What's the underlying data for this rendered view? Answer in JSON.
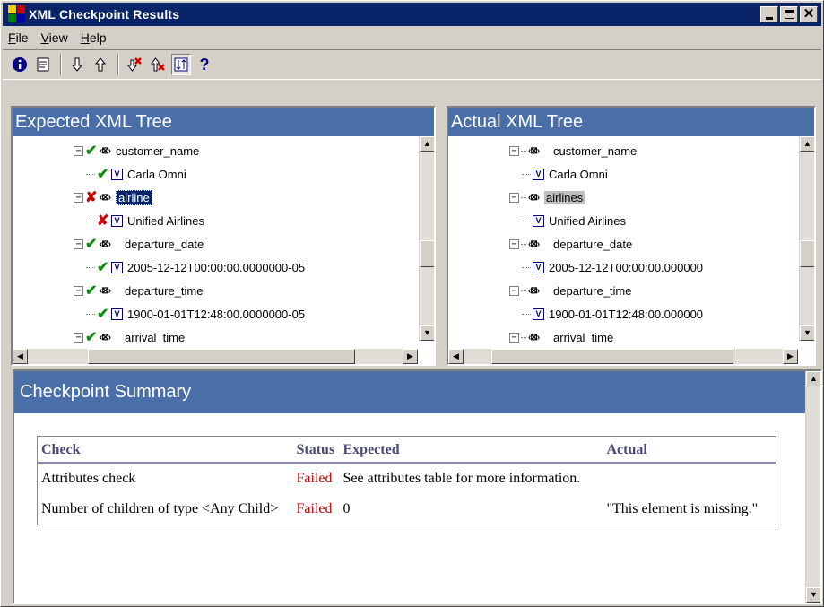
{
  "window": {
    "title": "XML Checkpoint Results"
  },
  "menu": [
    "File",
    "View",
    "Help"
  ],
  "toolbar": {
    "info_icon": "info-icon",
    "properties_icon": "properties-icon",
    "next_diff": "down-arrow-icon",
    "prev_diff": "up-arrow-icon",
    "next_fail": "next-failure-icon",
    "prev_fail": "previous-failure-icon",
    "sync": "synchronize-icon",
    "help": "?"
  },
  "expected": {
    "header": "Expected XML Tree",
    "nodes": [
      {
        "label": "customer_name"
      },
      {
        "label": "Carla Omni"
      },
      {
        "label": "airline"
      },
      {
        "label": "Unified Airlines"
      },
      {
        "label": "departure_date"
      },
      {
        "label": "2005-12-12T00:00:00.0000000-05"
      },
      {
        "label": "departure_time"
      },
      {
        "label": "1900-01-01T12:48:00.0000000-05"
      },
      {
        "label": "arrival_time"
      }
    ]
  },
  "actual": {
    "header": "Actual XML Tree",
    "nodes": [
      {
        "label": "customer_name"
      },
      {
        "label": "Carla Omni"
      },
      {
        "label": "airlines"
      },
      {
        "label": "Unified Airlines"
      },
      {
        "label": "departure_date"
      },
      {
        "label": "2005-12-12T00:00:00.000000"
      },
      {
        "label": "departure_time"
      },
      {
        "label": "1900-01-01T12:48:00.000000"
      },
      {
        "label": "arrival_time"
      }
    ]
  },
  "summary": {
    "header": "Checkpoint Summary",
    "columns": [
      "Check",
      "Status",
      "Expected",
      "Actual"
    ],
    "rows": [
      {
        "check": "Attributes check",
        "status": "Failed",
        "expected": "See attributes table for more information.",
        "actual": ""
      },
      {
        "check": "Number of children of type <Any Child>",
        "status": "Failed",
        "expected": "0",
        "actual": "\"This element is missing.\""
      }
    ]
  },
  "colors": {
    "title_bar": "#0a246a",
    "pane_header": "#4a6fa8",
    "pass": "#118a11",
    "fail": "#d10000"
  }
}
